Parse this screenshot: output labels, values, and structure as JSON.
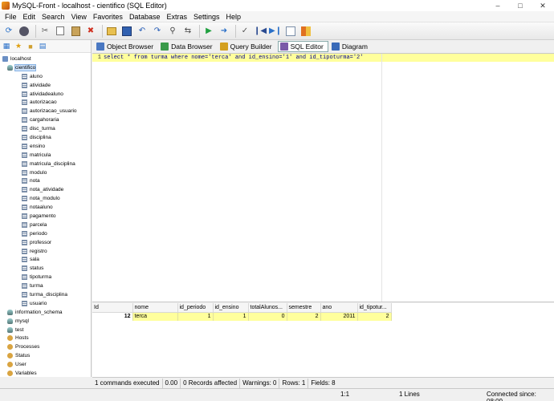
{
  "window": {
    "title": "MySQL-Front - localhost - cientifico  (SQL Editor)"
  },
  "menu": [
    "File",
    "Edit",
    "Search",
    "View",
    "Favorites",
    "Database",
    "Extras",
    "Settings",
    "Help"
  ],
  "toolbar": {
    "icons": [
      "refresh-icon",
      "stop-icon",
      "cut-icon",
      "copy-icon",
      "paste-icon",
      "delete-icon",
      "open-icon",
      "save-icon",
      "undo-icon",
      "redo-icon",
      "search-icon",
      "replace-icon",
      "run-icon",
      "run-selection-icon",
      "transaction-icon",
      "first-icon",
      "last-icon",
      "insert-icon",
      "grid-icon"
    ]
  },
  "tree": {
    "server": "localhost",
    "current_db": "cientifico",
    "tables": [
      "aluno",
      "atividade",
      "atividadealuno",
      "autorizacao",
      "autorizacao_usuario",
      "cargahoraria",
      "disc_turma",
      "disciplina",
      "ensino",
      "matricula",
      "matricula_disciplina",
      "modulo",
      "nota",
      "nota_atividade",
      "nota_modulo",
      "notaaluno",
      "pagamento",
      "parcela",
      "periodo",
      "professor",
      "registro",
      "sala",
      "status",
      "tipoturma",
      "turma",
      "turma_disciplina",
      "usuario"
    ],
    "other_dbs": [
      "information_schema",
      "mysql",
      "test"
    ],
    "misc": [
      "Hosts",
      "Processes",
      "Status",
      "User",
      "Variables"
    ]
  },
  "tabs": [
    {
      "label": "Object Browser",
      "icon": "object-browser-icon",
      "color": "#4a78c2"
    },
    {
      "label": "Data Browser",
      "icon": "data-browser-icon",
      "color": "#3a9a4a"
    },
    {
      "label": "Query Builder",
      "icon": "query-builder-icon",
      "color": "#d4a020"
    },
    {
      "label": "SQL Editor",
      "icon": "sql-editor-icon",
      "color": "#7a5aa8"
    },
    {
      "label": "Diagram",
      "icon": "diagram-icon",
      "color": "#3a6ab8"
    }
  ],
  "editor": {
    "line_number": "1",
    "sql": "select * from turma where nome='terca' and id_ensino='1' and id_tipoturma='2'"
  },
  "results": {
    "columns": [
      "Id",
      "nome",
      "id_periodo",
      "id_ensino",
      "totalAlunos...",
      "semestre",
      "ano",
      "id_tipotur..."
    ],
    "rows": [
      [
        "12",
        "terca",
        "1",
        "1",
        "0",
        "2",
        "2011",
        "2"
      ]
    ]
  },
  "status_query": {
    "executed": "1 commands executed",
    "time": "0.00",
    "affected": "0 Records affected",
    "warnings": "Warnings: 0",
    "rows": "Rows: 1",
    "fields": "Fields: 8"
  },
  "status_bottom": {
    "position": "1:1",
    "lines": "1 Lines",
    "connected": "Connected since: 08:09"
  }
}
